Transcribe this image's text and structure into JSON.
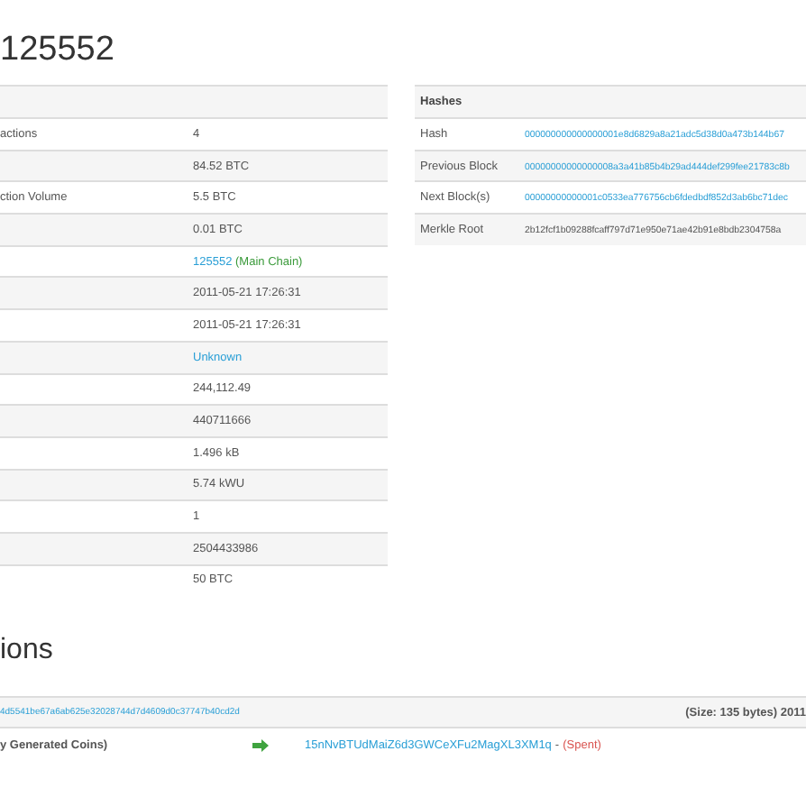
{
  "title": "125552",
  "summary": {
    "rows": [
      {
        "label": "actions",
        "value": "4",
        "kind": "text"
      },
      {
        "value": "84.52 BTC",
        "kind": "text"
      },
      {
        "label": "ction Volume",
        "value": "5.5 BTC",
        "kind": "text"
      },
      {
        "value": "0.01 BTC",
        "kind": "text"
      },
      {
        "value": "125552",
        "note": "(Main Chain)",
        "kind": "height"
      },
      {
        "value": "2011-05-21 17:26:31",
        "kind": "text"
      },
      {
        "value": "2011-05-21 17:26:31",
        "kind": "text"
      },
      {
        "value": "Unknown",
        "kind": "link"
      },
      {
        "value": "244,112.49",
        "kind": "text"
      },
      {
        "value": "440711666",
        "kind": "text"
      },
      {
        "value": "1.496 kB",
        "kind": "text"
      },
      {
        "value": "5.74 kWU",
        "kind": "text"
      },
      {
        "value": "1",
        "kind": "text"
      },
      {
        "value": "2504433986",
        "kind": "text"
      },
      {
        "value": "50 BTC",
        "kind": "text"
      }
    ]
  },
  "hashes": {
    "heading": "Hashes",
    "rows": [
      {
        "label": "Hash",
        "value": "000000000000000001e8d6829a8a21adc5d38d0a473b144b67",
        "kind": "link"
      },
      {
        "label": "Previous Block",
        "value": "00000000000000008a3a41b85b4b29ad444def299fee21783c8b",
        "kind": "link"
      },
      {
        "label": "Next Block(s)",
        "value": "00000000000001c0533ea776756cb6fdedbdf852d3ab6bc71dec",
        "kind": "link"
      },
      {
        "label": "Merkle Root",
        "value": "2b12fcf1b09288fcaff797d71e950e71ae42b91e8bdb2304758a",
        "kind": "text"
      }
    ]
  },
  "transactions": {
    "heading": "ions",
    "items": [
      {
        "hash": "4d5541be67a6ab625e32028744d7d4609d0c37747b40cd2d",
        "size": "(Size: 135 bytes) 2011",
        "input": "y Generated Coins)",
        "address": "15nNvBTUdMaiZ6d3GWCeXFu2MagXL3XM1q",
        "separator": "-",
        "status": "(Spent)"
      }
    ]
  }
}
